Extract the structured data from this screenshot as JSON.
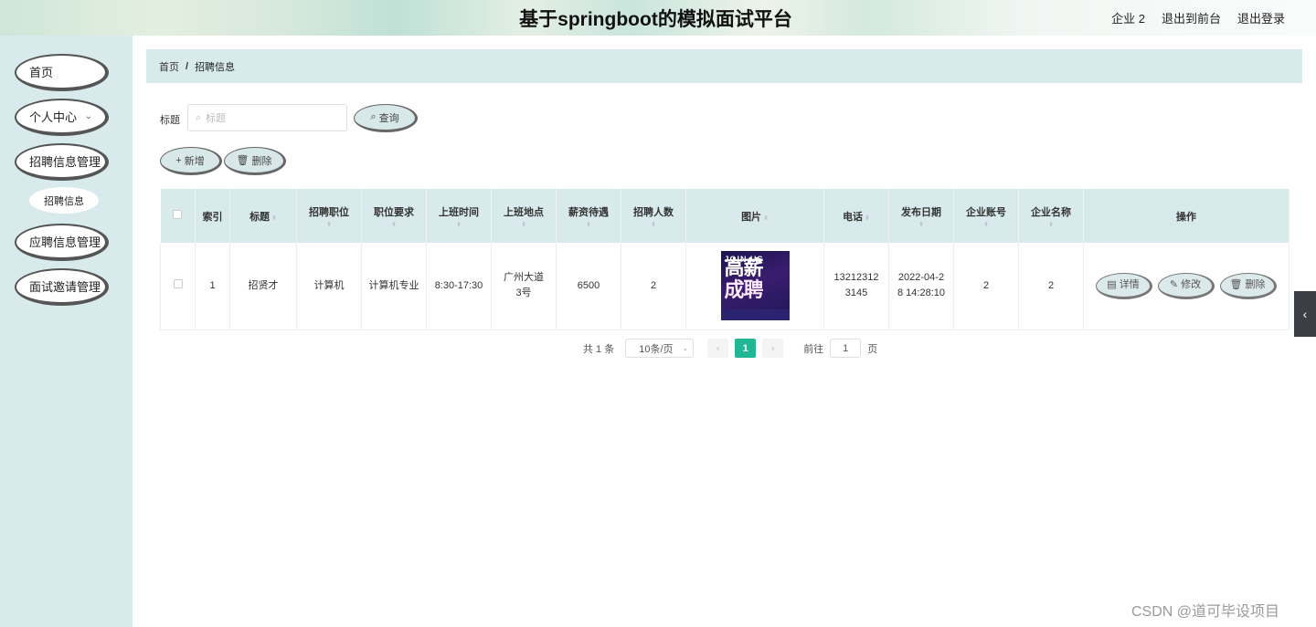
{
  "header": {
    "title": "基于springboot的模拟面试平台",
    "user": "企业 2",
    "back_front": "退出到前台",
    "logout": "退出登录"
  },
  "sidebar": {
    "items": [
      {
        "label": "首页",
        "chevron": ""
      },
      {
        "label": "个人中心",
        "chevron": "⌄"
      },
      {
        "label": "招聘信息管理",
        "chevron": ""
      },
      {
        "label": "应聘信息管理",
        "chevron": ""
      },
      {
        "label": "面试邀请管理",
        "chevron": ""
      }
    ],
    "sub": "招聘信息"
  },
  "breadcrumb": {
    "home": "首页",
    "sep": "/",
    "current": "招聘信息"
  },
  "search": {
    "label": "标题",
    "placeholder": "标题",
    "button": "查询"
  },
  "actions": {
    "add": "新增",
    "delete": "删除"
  },
  "table": {
    "columns": [
      "索引",
      "标题",
      "招聘职位",
      "职位要求",
      "上班时间",
      "上班地点",
      "薪资待遇",
      "招聘人数",
      "图片",
      "电话",
      "发布日期",
      "企业账号",
      "企业名称",
      "操作"
    ],
    "rows": [
      {
        "index": "1",
        "title": "招贤才",
        "position": "计算机",
        "requirement": "计算机专业",
        "work_time": "8:30-17:30",
        "location": "广州大道3号",
        "salary": "6500",
        "headcount": "2",
        "image_text": {
          "top": "JOIN US",
          "line1": "高薪",
          "line2": "成聘"
        },
        "phone": "132123123145",
        "date": "2022-04-28 14:28:10",
        "account": "2",
        "company": "2"
      }
    ],
    "row_actions": {
      "detail": "详情",
      "edit": "修改",
      "delete": "删除"
    }
  },
  "pagination": {
    "total": "共 1 条",
    "page_size": "10条/页",
    "current": "1",
    "goto_prefix": "前往",
    "goto_value": "1",
    "goto_suffix": "页"
  },
  "watermark": "CSDN @道可毕设项目",
  "colors": {
    "accent": "#21b795",
    "panel": "#d8eaec"
  }
}
